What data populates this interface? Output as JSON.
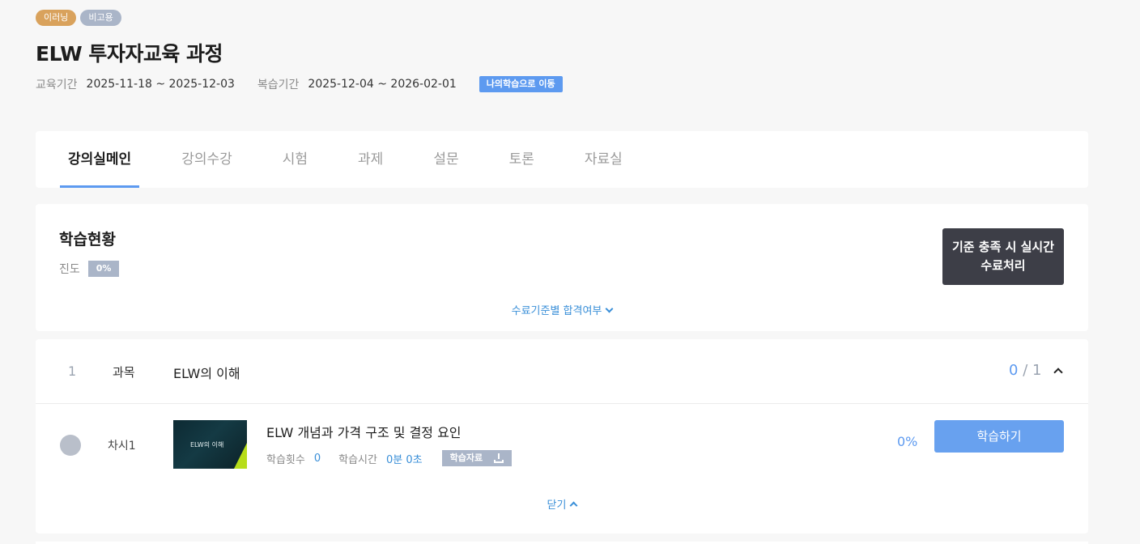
{
  "badges": {
    "elearning": "이러닝",
    "nonemployed": "비고용"
  },
  "course": {
    "title": "ELW 투자자교육 과정"
  },
  "period": {
    "edu_label": "교육기간",
    "edu_value": "2025-11-18 ~ 2025-12-03",
    "review_label": "복습기간",
    "review_value": "2025-12-04 ~ 2026-02-01",
    "go_button": "나의학습으로 이동"
  },
  "tabs": [
    {
      "label": "강의실메인",
      "active": true
    },
    {
      "label": "강의수강"
    },
    {
      "label": "시험"
    },
    {
      "label": "과제"
    },
    {
      "label": "설문"
    },
    {
      "label": "토론"
    },
    {
      "label": "자료실"
    }
  ],
  "status": {
    "title": "학습현황",
    "progress_label": "진도",
    "progress_value": "0%",
    "realtime_button": "기준 충족 시 실시간\n수료처리",
    "criteria_link": "수료기준별 합격여부"
  },
  "subject": {
    "number": "1",
    "type": "과목",
    "name": "ELW의 이해",
    "done": "0",
    "total": "/ 1",
    "lesson": {
      "number_label": "차시1",
      "thumbnail_text": "ELW의 이해",
      "title": "ELW 개념과 가격 구조 및 결정 요인",
      "count_label": "학습횟수",
      "count_value": "0",
      "time_label": "학습시간",
      "time_value": "0분 0초",
      "material_button": "학습자료",
      "percent": "0%",
      "study_button": "학습하기"
    },
    "close_label": "닫기"
  },
  "icons": {
    "criteria_chevron": "chevron-down-icon",
    "collapse": "chevron-up-icon",
    "download": "download-icon",
    "close_chevron": "chevron-up-icon"
  },
  "colors": {
    "accent": "#5d9af0",
    "link": "#3a8fd8",
    "badge_elearning": "#d9a25c",
    "badge_gray": "#aab5c8",
    "dark_button": "#3d3e47"
  }
}
